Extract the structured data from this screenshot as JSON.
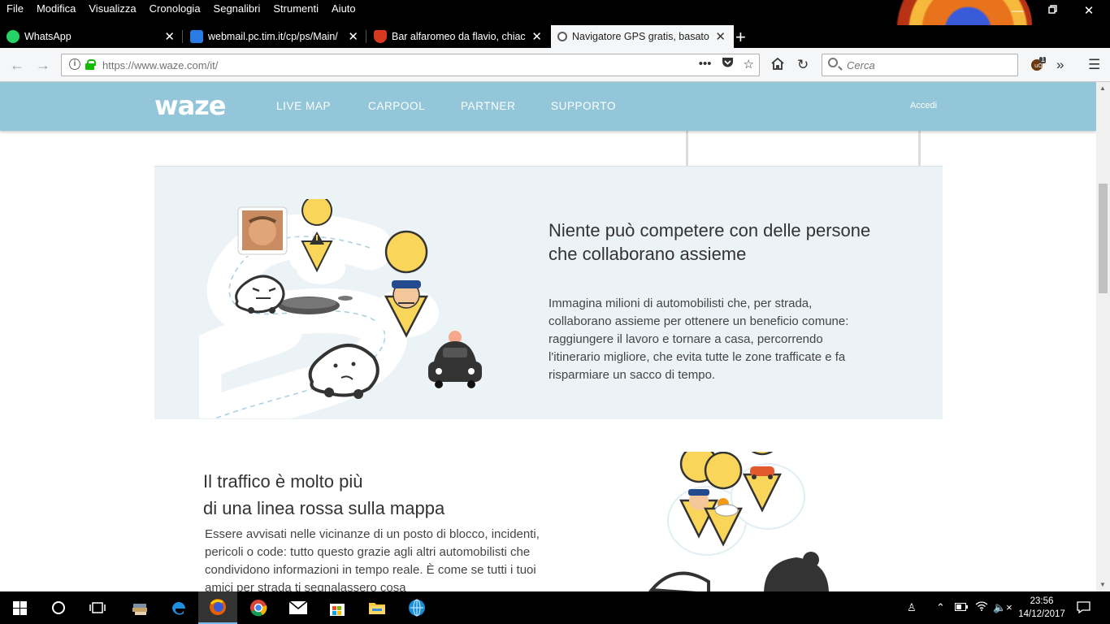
{
  "browser": {
    "menu": [
      "File",
      "Modifica",
      "Visualizza",
      "Cronologia",
      "Segnalibri",
      "Strumenti",
      "Aiuto"
    ],
    "tabs": [
      {
        "label": "WhatsApp",
        "icon": "whatsapp-icon",
        "color": "#25d366"
      },
      {
        "label": "webmail.pc.tim.it/cp/ps/Main/",
        "icon": "mail-icon",
        "color": "#2a7be4"
      },
      {
        "label": "Bar alfaromeo da flavio, chiacc",
        "icon": "shield-icon",
        "color": "#d63a1e"
      },
      {
        "label": "Navigatore GPS gratis, basato su",
        "icon": "waze-icon",
        "color": "#5a5a5a"
      }
    ],
    "url": "https://www.waze.com/it/",
    "search_placeholder": "Cerca",
    "extension_badge": "1"
  },
  "waze": {
    "logo": "waze",
    "nav": [
      "LIVE MAP",
      "CARPOOL",
      "PARTNER",
      "SUPPORTO"
    ],
    "login": "Accedi",
    "collab": {
      "title_line1": "Niente può competere con delle persone",
      "title_line2": "che collaborano assieme",
      "body": "Immagina milioni di automobilisti che, per strada, collaborano assieme per ottenere un beneficio comune: raggiungere il lavoro e tornare a casa, percorrendo l'itinerario migliore, che evita tutte le zone trafficate e fa risparmiare un sacco di tempo."
    },
    "traffic": {
      "title_line1": "Il traffico è molto più",
      "title_line2": "di una linea rossa sulla mappa",
      "body": "Essere avvisati nelle vicinanze di un posto di blocco, incidenti, pericoli o code: tutto questo grazie agli altri automobilisti che condividono informazioni in tempo reale. È come se tutti i tuoi amici per strada ti segnalassero cosa"
    }
  },
  "taskbar": {
    "time": "23:56",
    "date": "14/12/2017"
  },
  "colors": {
    "waze_header": "#93c6d9",
    "collab_bg": "#ecf3f6",
    "pin_yellow": "#f9d55a"
  }
}
